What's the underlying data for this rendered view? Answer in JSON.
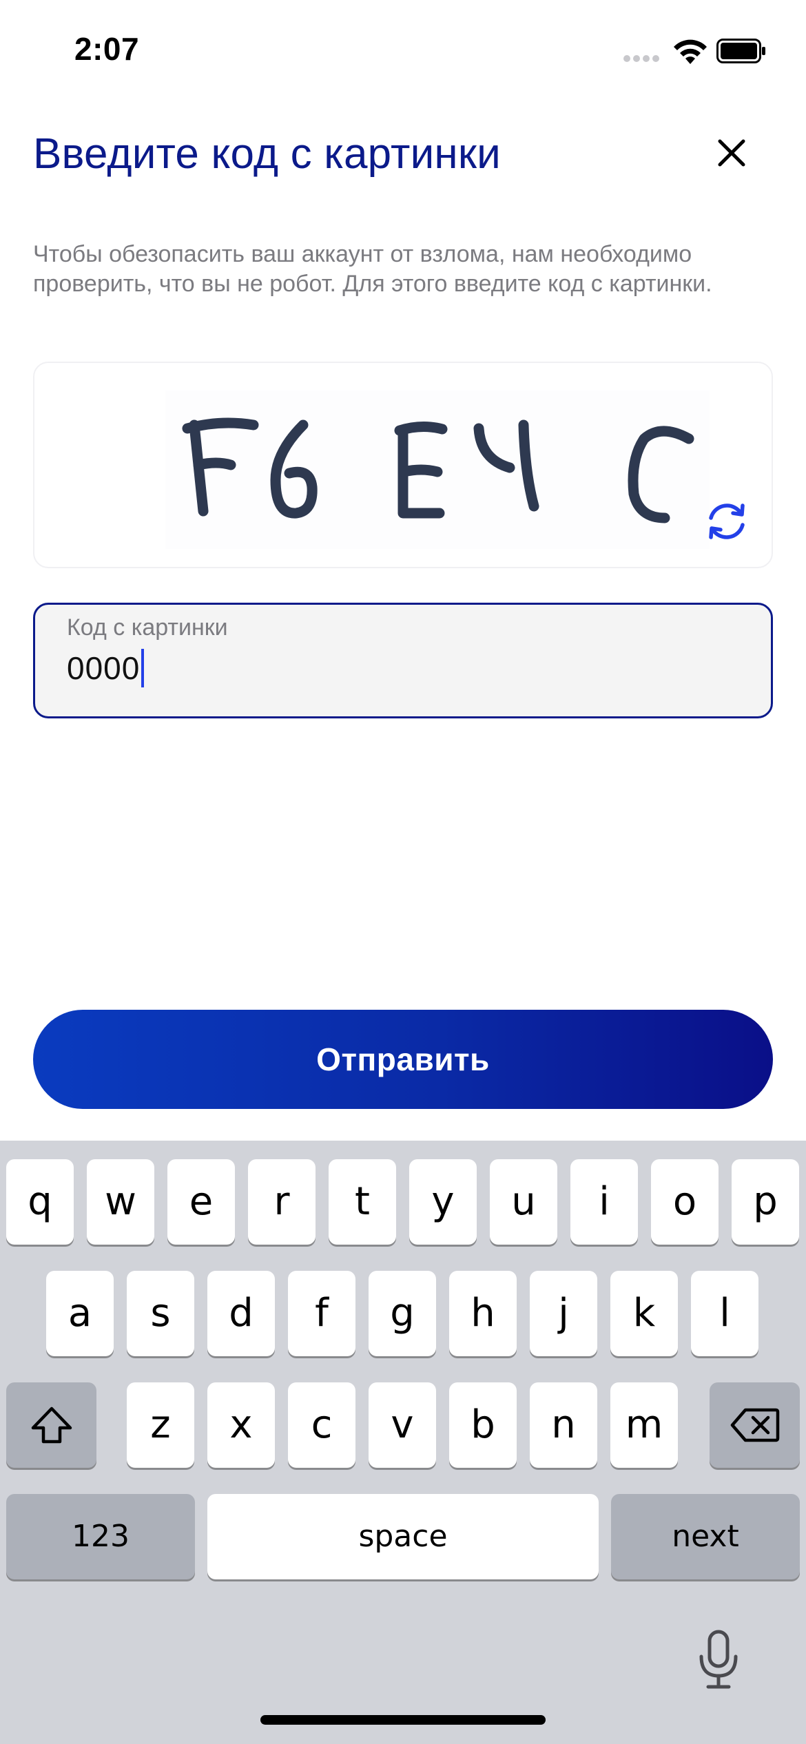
{
  "status_bar": {
    "time": "2:07"
  },
  "header": {
    "title": "Введите код с картинки",
    "close_icon": "close-icon"
  },
  "description": "Чтобы обезопасить ваш аккаунт от взлома, нам необходимо проверить, что вы не робот. Для этого введите код с картинки.",
  "captcha": {
    "text": "F6EYC",
    "refresh_icon": "refresh-icon",
    "accent_color": "#2340e8"
  },
  "code_input": {
    "label": "Код с картинки",
    "value": "0000"
  },
  "submit": {
    "label": "Отправить"
  },
  "keyboard": {
    "row1": [
      "q",
      "w",
      "e",
      "r",
      "t",
      "y",
      "u",
      "i",
      "o",
      "p"
    ],
    "row2": [
      "a",
      "s",
      "d",
      "f",
      "g",
      "h",
      "j",
      "k",
      "l"
    ],
    "row3": [
      "z",
      "x",
      "c",
      "v",
      "b",
      "n",
      "m"
    ],
    "numbers_label": "123",
    "space_label": "space",
    "return_label": "next",
    "shift_icon": "shift-icon",
    "delete_icon": "backspace-icon",
    "mic_icon": "microphone-icon"
  },
  "colors": {
    "primary": "#0b1a8a",
    "accent": "#2340e8",
    "keyboard_bg": "#d1d3d9"
  }
}
